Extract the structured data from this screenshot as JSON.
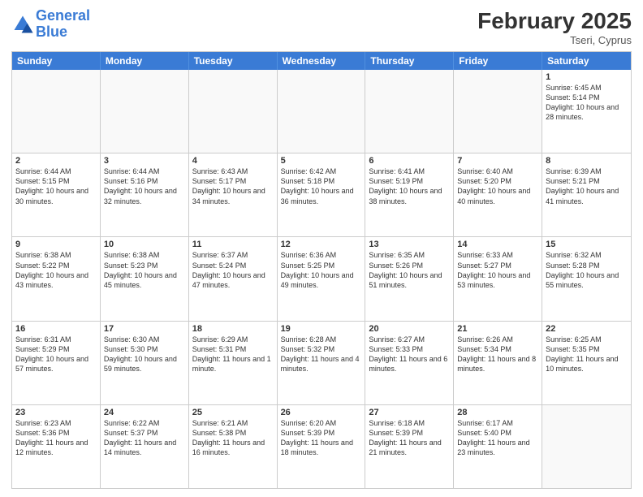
{
  "header": {
    "logo_general": "General",
    "logo_blue": "Blue",
    "month_year": "February 2025",
    "location": "Tseri, Cyprus"
  },
  "day_headers": [
    "Sunday",
    "Monday",
    "Tuesday",
    "Wednesday",
    "Thursday",
    "Friday",
    "Saturday"
  ],
  "weeks": [
    [
      {
        "num": "",
        "info": ""
      },
      {
        "num": "",
        "info": ""
      },
      {
        "num": "",
        "info": ""
      },
      {
        "num": "",
        "info": ""
      },
      {
        "num": "",
        "info": ""
      },
      {
        "num": "",
        "info": ""
      },
      {
        "num": "1",
        "info": "Sunrise: 6:45 AM\nSunset: 5:14 PM\nDaylight: 10 hours and 28 minutes."
      }
    ],
    [
      {
        "num": "2",
        "info": "Sunrise: 6:44 AM\nSunset: 5:15 PM\nDaylight: 10 hours and 30 minutes."
      },
      {
        "num": "3",
        "info": "Sunrise: 6:44 AM\nSunset: 5:16 PM\nDaylight: 10 hours and 32 minutes."
      },
      {
        "num": "4",
        "info": "Sunrise: 6:43 AM\nSunset: 5:17 PM\nDaylight: 10 hours and 34 minutes."
      },
      {
        "num": "5",
        "info": "Sunrise: 6:42 AM\nSunset: 5:18 PM\nDaylight: 10 hours and 36 minutes."
      },
      {
        "num": "6",
        "info": "Sunrise: 6:41 AM\nSunset: 5:19 PM\nDaylight: 10 hours and 38 minutes."
      },
      {
        "num": "7",
        "info": "Sunrise: 6:40 AM\nSunset: 5:20 PM\nDaylight: 10 hours and 40 minutes."
      },
      {
        "num": "8",
        "info": "Sunrise: 6:39 AM\nSunset: 5:21 PM\nDaylight: 10 hours and 41 minutes."
      }
    ],
    [
      {
        "num": "9",
        "info": "Sunrise: 6:38 AM\nSunset: 5:22 PM\nDaylight: 10 hours and 43 minutes."
      },
      {
        "num": "10",
        "info": "Sunrise: 6:38 AM\nSunset: 5:23 PM\nDaylight: 10 hours and 45 minutes."
      },
      {
        "num": "11",
        "info": "Sunrise: 6:37 AM\nSunset: 5:24 PM\nDaylight: 10 hours and 47 minutes."
      },
      {
        "num": "12",
        "info": "Sunrise: 6:36 AM\nSunset: 5:25 PM\nDaylight: 10 hours and 49 minutes."
      },
      {
        "num": "13",
        "info": "Sunrise: 6:35 AM\nSunset: 5:26 PM\nDaylight: 10 hours and 51 minutes."
      },
      {
        "num": "14",
        "info": "Sunrise: 6:33 AM\nSunset: 5:27 PM\nDaylight: 10 hours and 53 minutes."
      },
      {
        "num": "15",
        "info": "Sunrise: 6:32 AM\nSunset: 5:28 PM\nDaylight: 10 hours and 55 minutes."
      }
    ],
    [
      {
        "num": "16",
        "info": "Sunrise: 6:31 AM\nSunset: 5:29 PM\nDaylight: 10 hours and 57 minutes."
      },
      {
        "num": "17",
        "info": "Sunrise: 6:30 AM\nSunset: 5:30 PM\nDaylight: 10 hours and 59 minutes."
      },
      {
        "num": "18",
        "info": "Sunrise: 6:29 AM\nSunset: 5:31 PM\nDaylight: 11 hours and 1 minute."
      },
      {
        "num": "19",
        "info": "Sunrise: 6:28 AM\nSunset: 5:32 PM\nDaylight: 11 hours and 4 minutes."
      },
      {
        "num": "20",
        "info": "Sunrise: 6:27 AM\nSunset: 5:33 PM\nDaylight: 11 hours and 6 minutes."
      },
      {
        "num": "21",
        "info": "Sunrise: 6:26 AM\nSunset: 5:34 PM\nDaylight: 11 hours and 8 minutes."
      },
      {
        "num": "22",
        "info": "Sunrise: 6:25 AM\nSunset: 5:35 PM\nDaylight: 11 hours and 10 minutes."
      }
    ],
    [
      {
        "num": "23",
        "info": "Sunrise: 6:23 AM\nSunset: 5:36 PM\nDaylight: 11 hours and 12 minutes."
      },
      {
        "num": "24",
        "info": "Sunrise: 6:22 AM\nSunset: 5:37 PM\nDaylight: 11 hours and 14 minutes."
      },
      {
        "num": "25",
        "info": "Sunrise: 6:21 AM\nSunset: 5:38 PM\nDaylight: 11 hours and 16 minutes."
      },
      {
        "num": "26",
        "info": "Sunrise: 6:20 AM\nSunset: 5:39 PM\nDaylight: 11 hours and 18 minutes."
      },
      {
        "num": "27",
        "info": "Sunrise: 6:18 AM\nSunset: 5:39 PM\nDaylight: 11 hours and 21 minutes."
      },
      {
        "num": "28",
        "info": "Sunrise: 6:17 AM\nSunset: 5:40 PM\nDaylight: 11 hours and 23 minutes."
      },
      {
        "num": "",
        "info": ""
      }
    ]
  ]
}
